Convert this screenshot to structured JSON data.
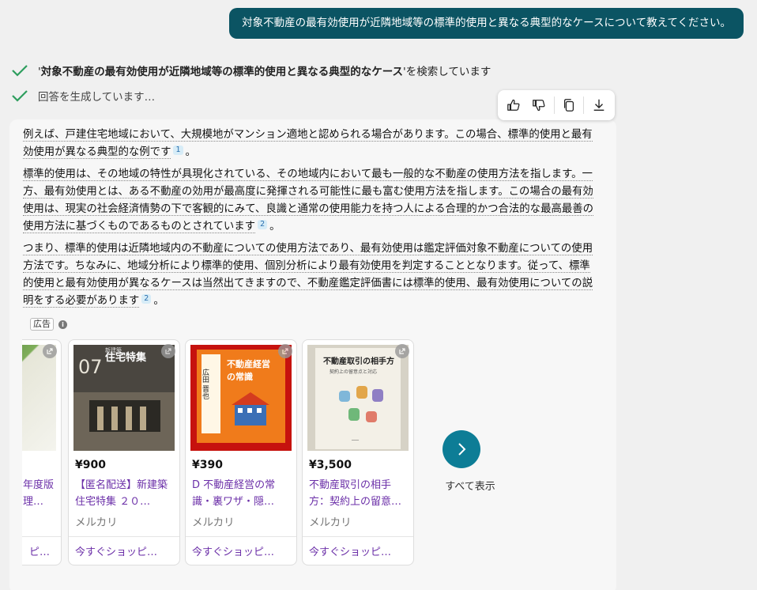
{
  "user_message": "対象不動産の最有効使用が近隣地域等の標準的使用と異なる典型的なケースについて教えてください。",
  "status": {
    "searching_query": "対象不動産の最有効使用が近隣地域等の標準的使用と異なる典型的なケース",
    "searching_suffix": " を検索しています",
    "generating": "回答を生成しています…"
  },
  "answer": {
    "p1_text": "例えば、戸建住宅地域において、大規模地がマンション適地と認められる場合があります。この場合、標準的使用と最有効使用が異なる典型的な例です",
    "p1_cite": "1",
    "p2_text": "標準的使用は、その地域の特性が具現化されている、その地域内において最も一般的な不動産の使用方法を指します。一方、最有効使用とは、ある不動産の効用が最高度に発揮される可能性に最も富む使用方法を指します。この場合の最有効使用は、現実の社会経済情勢の下で客観的にみて、良識と通常の使用能力を持つ人による合理的かつ合法的な最高最善の使用方法に基づくものであるものとされています",
    "p2_cite": "2",
    "p3_text": "つまり、標準的使用は近隣地域内の不動産についての使用方法であり、最有効使用は鑑定評価対象不動産についての使用方法です。ちなみに、地域分析により標準的使用、個別分析により最有効使用を判定することとなります。従って、標準的使用と最有効使用が異なるケースは当然出てきますので、不動産鑑定評価書には標準的使用、最有効使用についての説明をする必要があります",
    "p3_cite": "2",
    "period": "。"
  },
  "ad": {
    "label": "広告",
    "info_glyph": "i",
    "see_all": "すべて表示",
    "products": [
      {
        "price": "",
        "title": "年度版 理…",
        "seller": "",
        "shop": "ピ…"
      },
      {
        "price": "¥900",
        "title": "【匿名配送】新建築 住宅特集 ２０…",
        "seller": "メルカリ",
        "shop": "今すぐショッピ…",
        "cover_text": "住宅特集",
        "cover_num": "07",
        "cover_sub": "新建築"
      },
      {
        "price": "¥390",
        "title": "D 不動産経営の常識・裏ワザ・隠…",
        "seller": "メルカリ",
        "shop": "今すぐショッピ…",
        "cover_text": "不動産経営の常識・裏ワザ・隠しワザ",
        "cover_author": "広田 晋也"
      },
      {
        "price": "¥3,500",
        "title": "不動産取引の相手方：契約上の留意…",
        "seller": "メルカリ",
        "shop": "今すぐショッピ…",
        "cover_text": "不動産取引の相手方",
        "cover_sub": "契約上の留意点と対応"
      }
    ]
  },
  "colors": {
    "user_bubble": "#0b5463",
    "check": "#2e9e5e",
    "link_purple": "#6b2fa8",
    "next_button": "#0d7d96"
  },
  "icons": [
    "check-icon",
    "thumbs-up-icon",
    "thumbs-down-icon",
    "copy-icon",
    "download-icon",
    "external-link-icon",
    "chevron-right-icon",
    "info-icon"
  ]
}
